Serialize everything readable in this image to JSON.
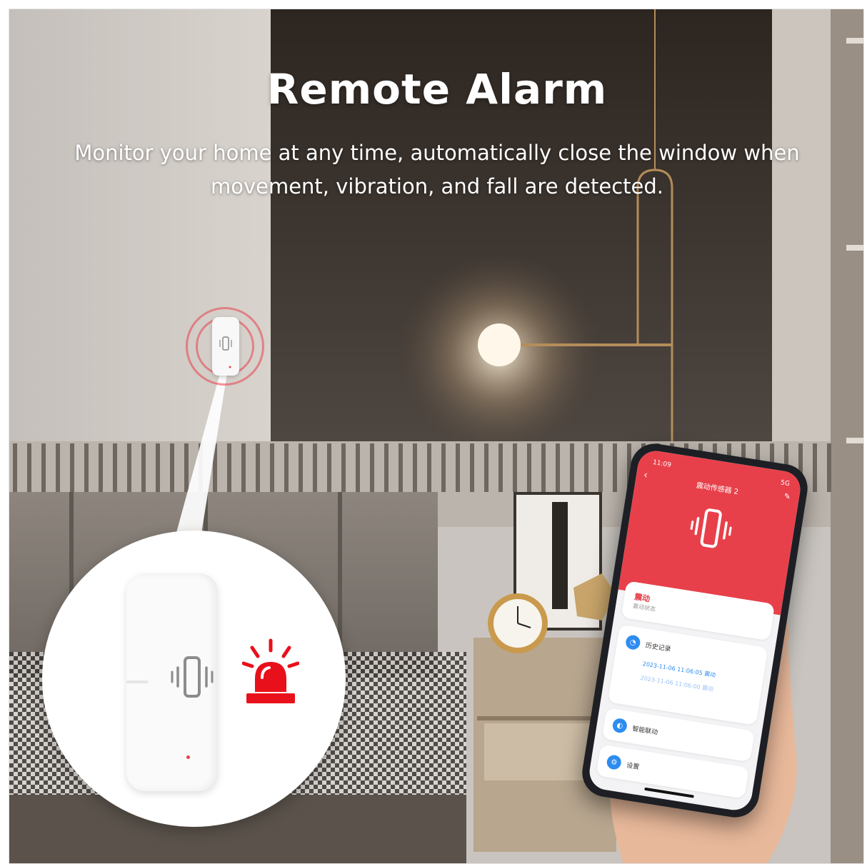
{
  "headline": "Remote Alarm",
  "subline_1": "Monitor your home at any time, automatically close the window when",
  "subline_2": "movement, vibration, and fall are detected.",
  "app": {
    "status_time": "11:09",
    "status_right": "5G",
    "title": "震动传感器 2",
    "status_main": "震动",
    "status_sub": "震动状态",
    "history_label": "历史记录",
    "history_entries": [
      "2023-11-06 11:06:05 震动",
      "2023-11-06 11:06:00 震动"
    ],
    "link_label": "智能联动",
    "settings_label": "设置",
    "accent": "#e8404a",
    "link_color": "#2d8cf0"
  },
  "icons": {
    "vibration": "vibration-icon",
    "siren": "siren-icon",
    "history": "clock-icon",
    "link": "toggle-icon",
    "settings": "gear-icon"
  }
}
